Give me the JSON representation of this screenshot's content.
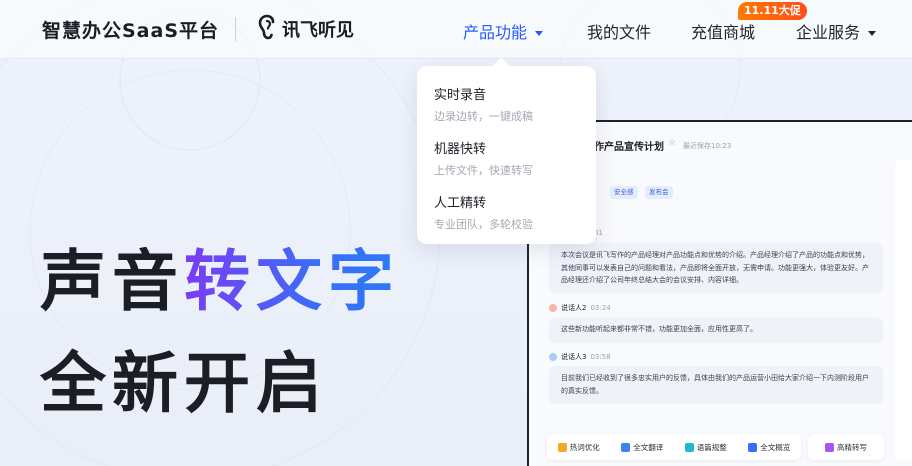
{
  "header": {
    "brand": "智慧办公SaaS平台",
    "logo_text": "讯飞听见",
    "nav": [
      {
        "label": "产品功能",
        "active": true,
        "has_dropdown": true
      },
      {
        "label": "我的文件",
        "active": false,
        "has_dropdown": false
      },
      {
        "label": "充值商城",
        "active": false,
        "has_dropdown": false
      },
      {
        "label": "企业服务",
        "active": false,
        "has_dropdown": true
      }
    ],
    "promo_badge": "11.11大促"
  },
  "dropdown": {
    "items": [
      {
        "title": "实时录音",
        "desc": "边录边转，一键成稿"
      },
      {
        "title": "机器快转",
        "desc": "上传文件，快速转写"
      },
      {
        "title": "人工精转",
        "desc": "专业团队，多轮校验"
      }
    ]
  },
  "hero": {
    "line1_prefix": "声音",
    "line1_accent": "转文字",
    "line2": "全新开启"
  },
  "preview": {
    "doc_title": "作产品宣传计划",
    "saved": "最近保存10:23",
    "tags": [
      "安全感",
      "发布会"
    ],
    "first_time": "01",
    "segments": [
      {
        "speaker": "",
        "time": "",
        "text": "本次会议是讯飞写作的产品经理对产品功能点和优势的介绍。产品经理介绍了产品的功能点和优势，其他同事可以发表自己的问题和看法，产品即将全面开放，无需申请。功能更强大，体验更友好。产品经理还介绍了公司年终总结大会的会议安排、内容详细。"
      },
      {
        "speaker": "说话人2",
        "time": "03:24",
        "text": "这些新功能听起来都非常不错，功能更加全面，应用性更高了。"
      },
      {
        "speaker": "说话人3",
        "time": "03:58",
        "text": "目前我们已经收到了很多忠实用户的反馈，具体由我们的产品运营小田给大家介绍一下内测阶段用户的真实反馈。"
      }
    ],
    "toolbar": [
      {
        "label": "热词优化",
        "icon": "hotword-icon",
        "color": "#f5a623"
      },
      {
        "label": "全文翻译",
        "icon": "translate-icon",
        "color": "#3b82f6"
      },
      {
        "label": "语篇规整",
        "icon": "format-icon",
        "color": "#22b8cf"
      },
      {
        "label": "全文概览",
        "icon": "overview-icon",
        "color": "#3b6df6"
      }
    ],
    "hq_button": {
      "label": "高精转写",
      "icon": "hq-icon",
      "color": "#a855f7"
    }
  },
  "colors": {
    "accent": "#2a5bf5",
    "promo": "#ff6a00"
  }
}
